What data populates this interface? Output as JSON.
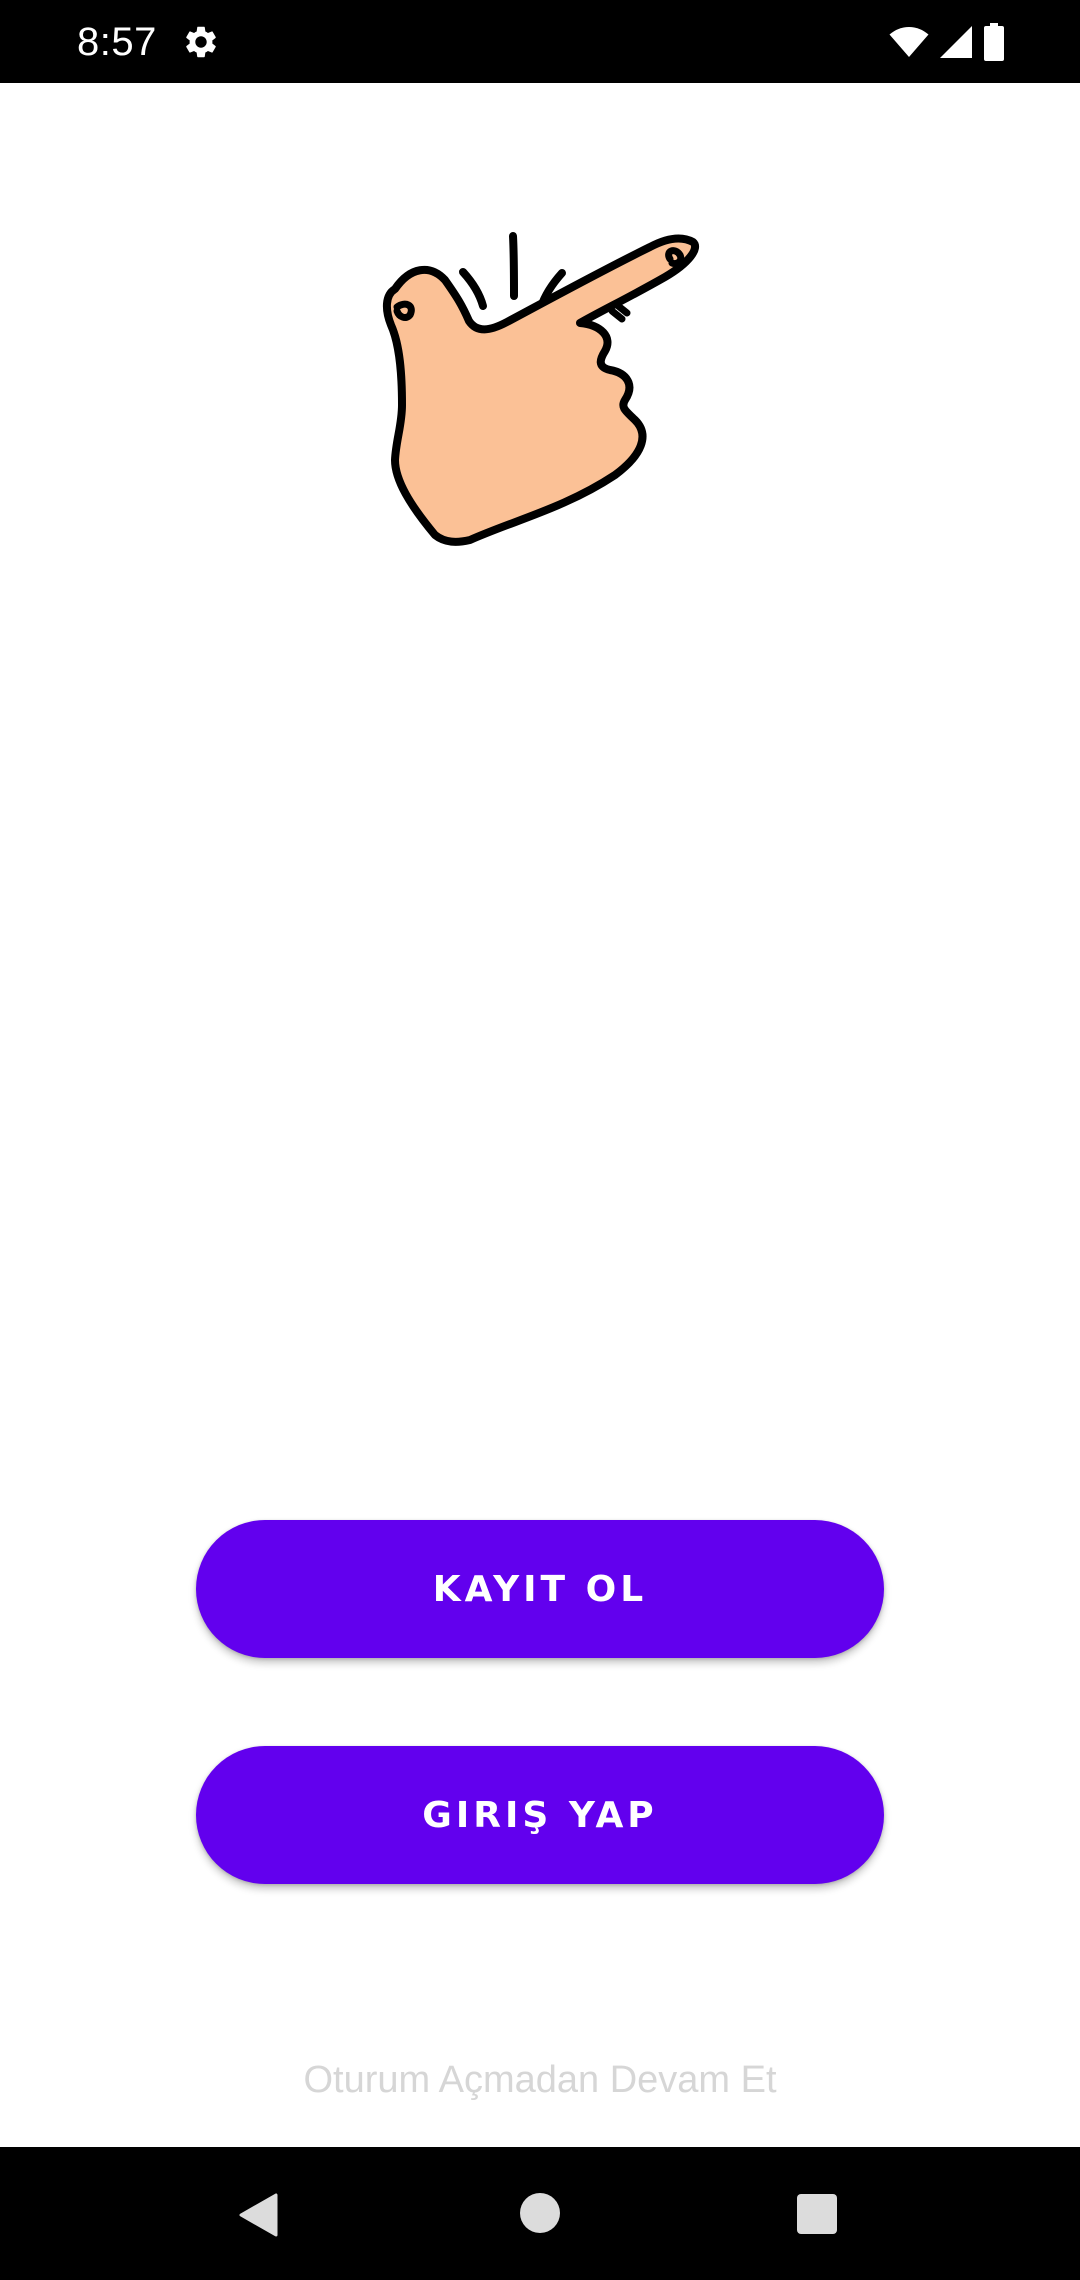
{
  "status_bar": {
    "time": "8:57",
    "icons": [
      "gear-icon",
      "wifi-icon",
      "cell-signal-icon",
      "battery-icon"
    ]
  },
  "hero": {
    "illustration": "snapping-fingers-hand"
  },
  "actions": {
    "register_label": "KAYIT OL",
    "login_label": "GIRIŞ YAP",
    "guest_label": "Oturum Açmadan Devam Et"
  },
  "nav_bar": {
    "icons": [
      "back-icon",
      "home-icon",
      "recents-icon"
    ]
  },
  "colors": {
    "primary": "#6200ee",
    "skin": "#fbc196",
    "guest_text": "#d6d6d6"
  }
}
